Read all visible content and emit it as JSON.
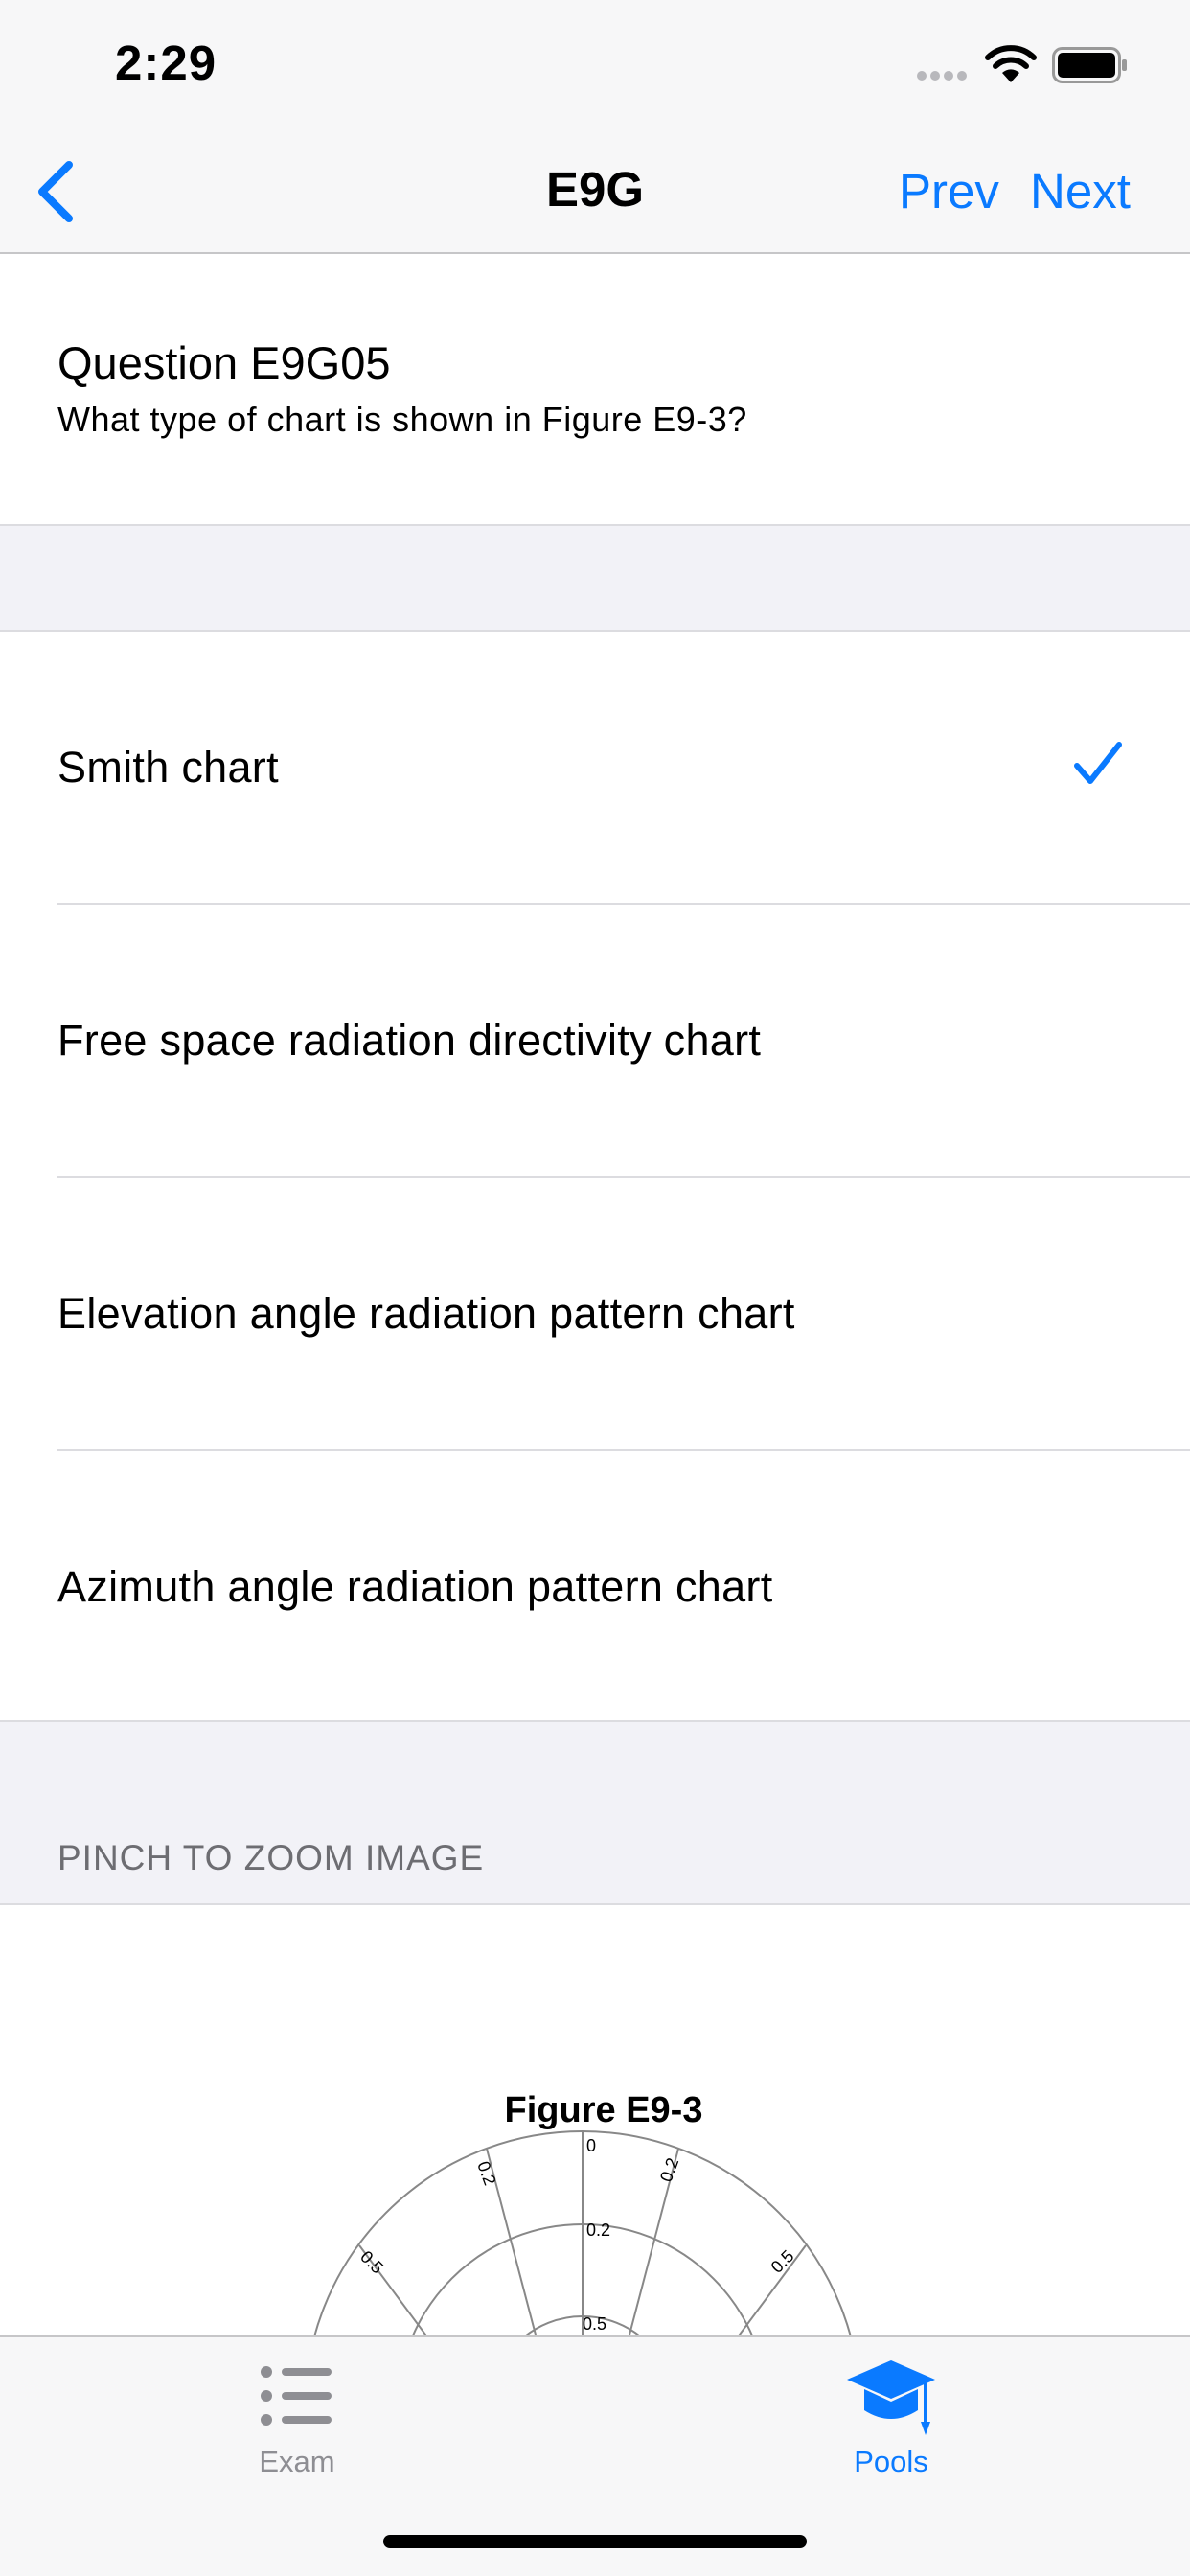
{
  "status_bar": {
    "time": "2:29"
  },
  "nav": {
    "title": "E9G",
    "prev_label": "Prev",
    "next_label": "Next"
  },
  "question": {
    "title": "Question E9G05",
    "text": "What type of chart is shown in Figure E9-3?"
  },
  "answers": [
    {
      "label": "Smith chart",
      "selected": true
    },
    {
      "label": "Free space radiation directivity chart",
      "selected": false
    },
    {
      "label": "Elevation angle radiation pattern chart",
      "selected": false
    },
    {
      "label": "Azimuth angle radiation pattern chart",
      "selected": false
    }
  ],
  "image_section": {
    "header": "PINCH TO ZOOM IMAGE",
    "figure_title": "Figure E9-3",
    "tick_labels": [
      "0",
      "0.2",
      "0.2",
      "0.2",
      "0.5",
      "0.5",
      "0.5"
    ]
  },
  "tab_bar": {
    "items": [
      {
        "label": "Exam",
        "icon": "list-icon",
        "active": false
      },
      {
        "label": "Pools",
        "icon": "graduation-cap-icon",
        "active": true
      }
    ]
  },
  "colors": {
    "accent": "#0a7aff",
    "inactive": "#8e8e93",
    "background": "#f2f2f7"
  }
}
